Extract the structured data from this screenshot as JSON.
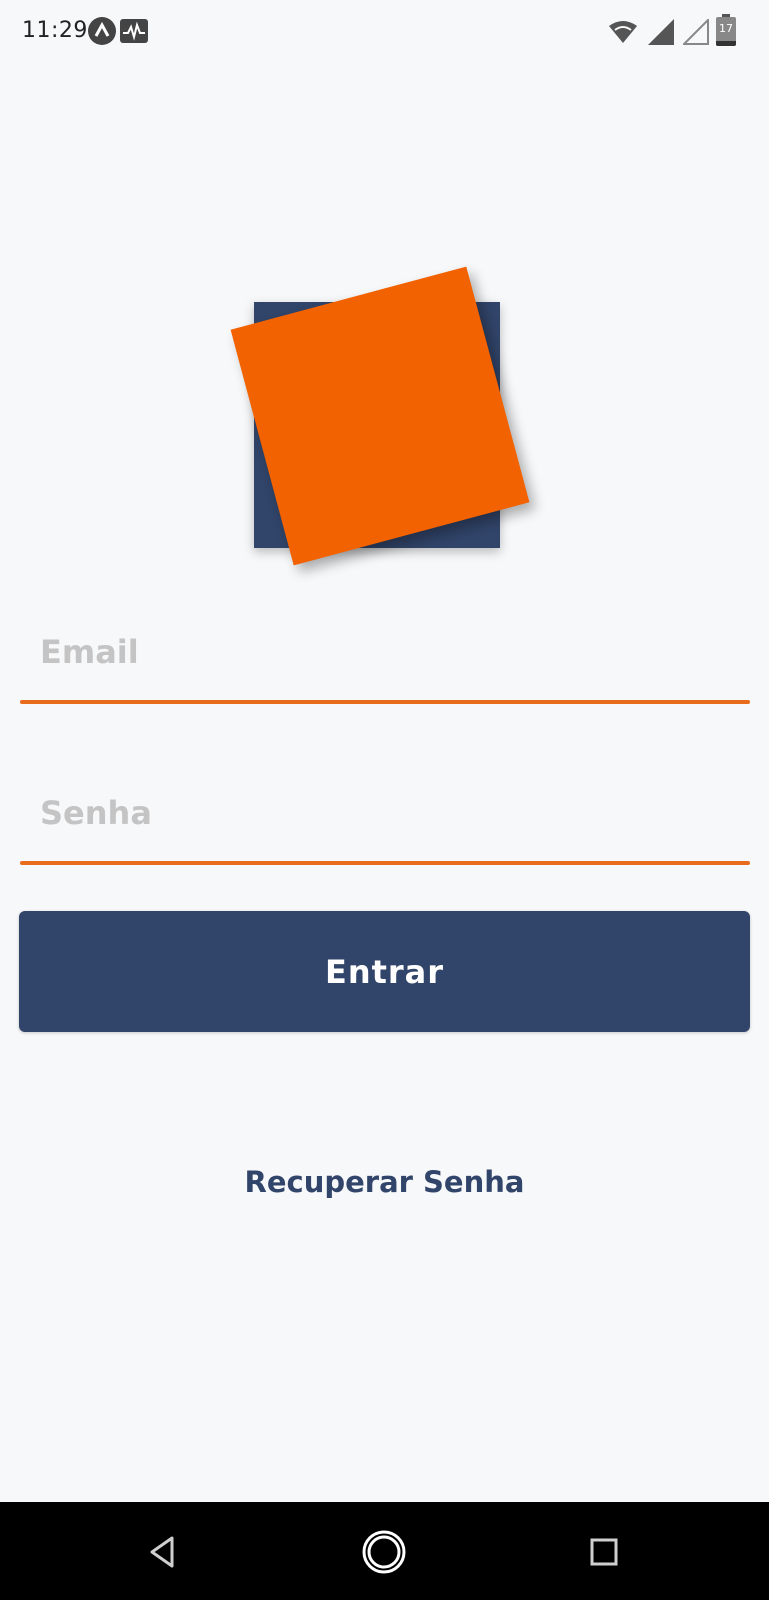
{
  "status_bar": {
    "time": "11:29",
    "battery_level": "17",
    "icons": [
      "app-notification-icon",
      "activity-icon",
      "wifi-icon",
      "signal-icon",
      "signal-empty-icon",
      "battery-icon"
    ]
  },
  "logo": {
    "back_color": "#314469",
    "front_color": "#f26200"
  },
  "form": {
    "email_placeholder": "Email",
    "email_value": "",
    "password_placeholder": "Senha",
    "password_value": "",
    "underline_color": "#e96b1c"
  },
  "login_button": {
    "label": "Entrar",
    "color": "#314469"
  },
  "recover_link": {
    "label": "Recuperar Senha"
  },
  "nav_bar": {
    "buttons": [
      "back-icon",
      "home-icon",
      "recents-icon"
    ]
  }
}
